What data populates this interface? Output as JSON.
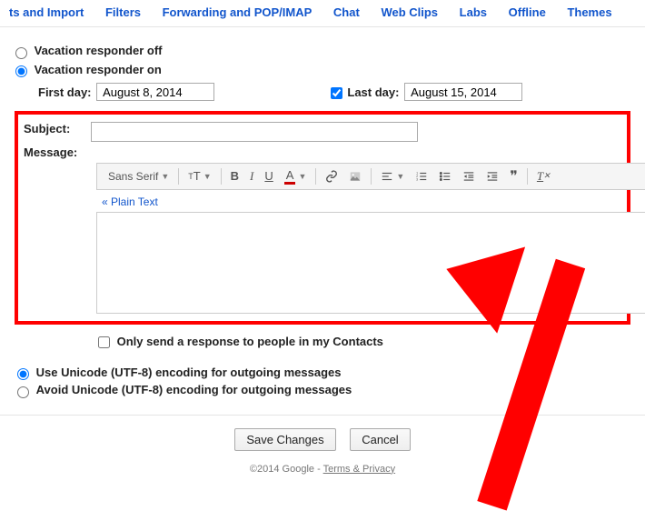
{
  "tabs": {
    "t0": "ts and Import",
    "t1": "Filters",
    "t2": "Forwarding and POP/IMAP",
    "t3": "Chat",
    "t4": "Web Clips",
    "t5": "Labs",
    "t6": "Offline",
    "t7": "Themes"
  },
  "vacation": {
    "off_label": "Vacation responder off",
    "on_label": "Vacation responder on",
    "first_day_label": "First day:",
    "first_day_value": "August 8, 2014",
    "last_day_label": "Last day:",
    "last_day_value": "August 15, 2014",
    "subject_label": "Subject:",
    "subject_value": "",
    "message_label": "Message:",
    "font_family_btn": "Sans Serif",
    "plain_text_link": "« Plain Text",
    "contacts_only_label": "Only send a response to people in my Contacts"
  },
  "encoding": {
    "use_label": "Use Unicode (UTF-8) encoding for outgoing messages",
    "avoid_label": "Avoid Unicode (UTF-8) encoding for outgoing messages"
  },
  "buttons": {
    "save": "Save Changes",
    "cancel": "Cancel"
  },
  "footer": {
    "copyright": "©2014 Google - ",
    "terms_link": "Terms & Privacy"
  }
}
